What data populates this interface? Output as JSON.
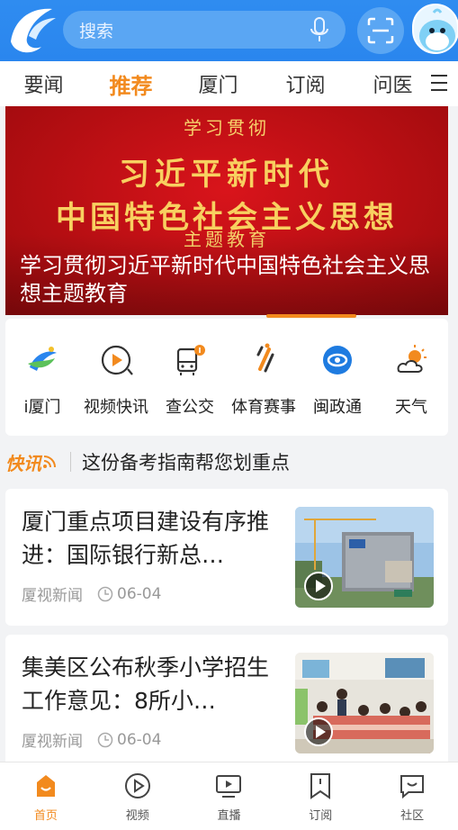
{
  "header": {
    "search_placeholder": "搜索"
  },
  "nav": {
    "tabs": [
      "要闻",
      "推荐",
      "厦门",
      "订阅",
      "问医"
    ],
    "active_tab": "推荐"
  },
  "banner": {
    "sub_top": "学习贯彻",
    "line1": "习近平新时代",
    "line2": "中国特色社会主义思想",
    "sub_bottom": "主题教育",
    "caption": "学习贯彻习近平新时代中国特色社会主义思想主题教育"
  },
  "services": [
    {
      "label": "i厦门",
      "icon": "i-xiamen-icon"
    },
    {
      "label": "视频快讯",
      "icon": "video-news-icon"
    },
    {
      "label": "查公交",
      "icon": "bus-icon"
    },
    {
      "label": "体育赛事",
      "icon": "sports-icon"
    },
    {
      "label": "闽政通",
      "icon": "minzhengtong-icon"
    },
    {
      "label": "天气",
      "icon": "weather-icon"
    }
  ],
  "flash": {
    "badge": "快讯",
    "text": "这份备考指南帮您划重点"
  },
  "news": [
    {
      "title": "厦门重点项目建设有序推进：国际银行新总…",
      "source": "厦视新闻",
      "date": "06-04"
    },
    {
      "title": "集美区公布秋季小学招生工作意见：8所小…",
      "source": "厦视新闻",
      "date": "06-04"
    }
  ],
  "bottom_nav": [
    {
      "label": "首页",
      "icon": "home-icon",
      "active": true
    },
    {
      "label": "视频",
      "icon": "video-icon",
      "active": false
    },
    {
      "label": "直播",
      "icon": "live-icon",
      "active": false
    },
    {
      "label": "订阅",
      "icon": "subscribe-icon",
      "active": false
    },
    {
      "label": "社区",
      "icon": "community-icon",
      "active": false
    }
  ],
  "colors": {
    "brand_blue": "#2f8cf0",
    "accent_orange": "#f28a1e",
    "banner_red": "#c8111a",
    "banner_gold": "#f8d060"
  }
}
